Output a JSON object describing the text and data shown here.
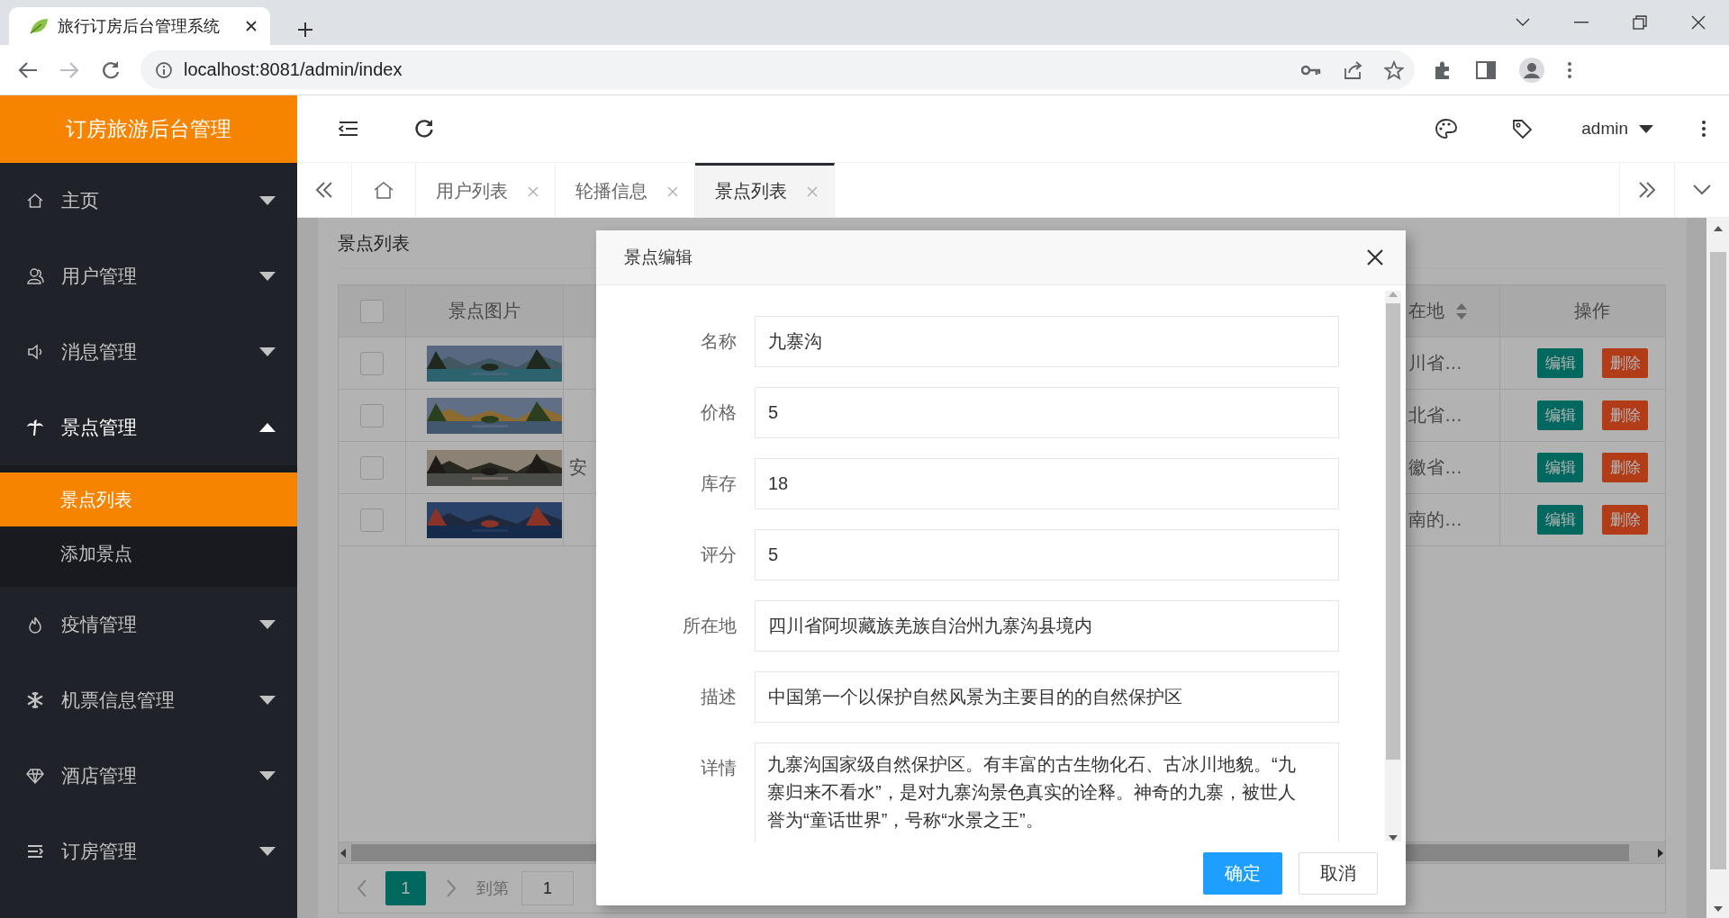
{
  "browser": {
    "tab_title": "旅行订房后台管理系统",
    "url": "localhost:8081/admin/index"
  },
  "sidebar": {
    "logo": "订房旅游后台管理",
    "items": [
      {
        "label": "主页",
        "expanded": false
      },
      {
        "label": "用户管理",
        "expanded": false
      },
      {
        "label": "消息管理",
        "expanded": false
      },
      {
        "label": "景点管理",
        "expanded": true,
        "children": [
          {
            "label": "景点列表",
            "selected": true
          },
          {
            "label": "添加景点",
            "selected": false
          }
        ]
      },
      {
        "label": "疫情管理",
        "expanded": false
      },
      {
        "label": "机票信息管理",
        "expanded": false
      },
      {
        "label": "酒店管理",
        "expanded": false
      },
      {
        "label": "订房管理",
        "expanded": false
      }
    ]
  },
  "header": {
    "user": "admin"
  },
  "tabs": [
    {
      "label": "用户列表",
      "selected": false
    },
    {
      "label": "轮播信息",
      "selected": false
    },
    {
      "label": "景点列表",
      "selected": true
    }
  ],
  "page": {
    "title": "景点列表",
    "table": {
      "header_checked": false,
      "columns": [
        {
          "label": "景点图片"
        },
        {
          "label": "在地",
          "sortable": true
        },
        {
          "label": "操作"
        }
      ],
      "rows": [
        {
          "checked": false,
          "picture": {
            "kind": "picture"
          },
          "location": "川省…",
          "actions": [
            {
              "label": "编辑",
              "kind": "edit"
            },
            {
              "label": "删除",
              "kind": "delete"
            }
          ]
        },
        {
          "checked": false,
          "picture": {
            "kind": "picture"
          },
          "location": "北省…",
          "actions": [
            {
              "label": "编辑",
              "kind": "edit"
            },
            {
              "label": "删除",
              "kind": "delete"
            }
          ]
        },
        {
          "checked": false,
          "picture": {
            "kind": "picture"
          },
          "column_3": "安",
          "location": "徽省…",
          "actions": [
            {
              "label": "编辑",
              "kind": "edit"
            },
            {
              "label": "删除",
              "kind": "delete"
            }
          ]
        },
        {
          "checked": false,
          "picture": {
            "kind": "picture"
          },
          "location": "南的…",
          "actions": [
            {
              "label": "编辑",
              "kind": "edit"
            },
            {
              "label": "删除",
              "kind": "delete"
            }
          ]
        }
      ]
    },
    "pagination": {
      "pages": [
        {
          "label": "1",
          "selected": true
        }
      ],
      "goto_label": "到第",
      "goto_value": "1"
    }
  },
  "dialog": {
    "title": "景点编辑",
    "fields": [
      {
        "label": "名称",
        "value": "九寨沟",
        "kind": "input"
      },
      {
        "label": "价格",
        "value": "5",
        "kind": "input"
      },
      {
        "label": "库存",
        "value": "18",
        "kind": "input"
      },
      {
        "label": "评分",
        "value": "5",
        "kind": "input"
      },
      {
        "label": "所在地",
        "value": "四川省阿坝藏族羌族自治州九寨沟县境内",
        "kind": "input"
      },
      {
        "label": "描述",
        "value": "中国第一个以保护自然风景为主要目的的自然保护区",
        "kind": "input"
      },
      {
        "label": "详情",
        "value": "九寨沟国家级自然保护区。有丰富的古生物化石、古冰川地貌。“九寨归来不看水”，是对九寨沟景色真实的诠释。神奇的九寨，被世人誉为“童话世界”，号称“水景之王”。",
        "kind": "textarea"
      }
    ],
    "buttons": [
      {
        "label": "确定",
        "kind": "primary"
      },
      {
        "label": "取消",
        "kind": "default"
      }
    ]
  }
}
